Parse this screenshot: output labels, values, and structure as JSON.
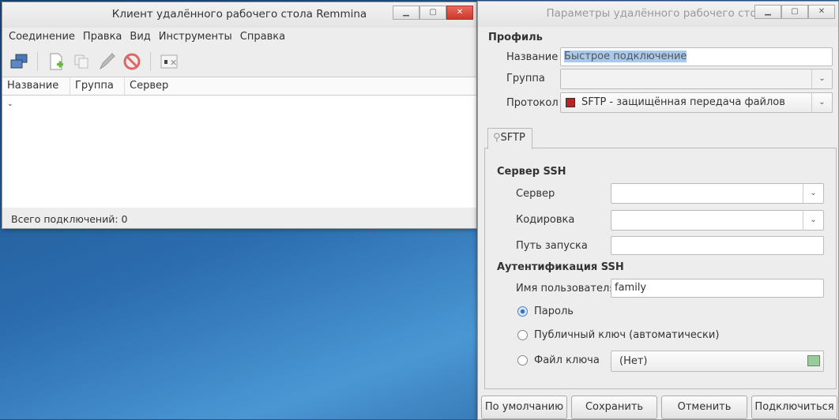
{
  "main_window": {
    "title": "Клиент удалённого рабочего стола Remmina",
    "menu": [
      "Соединение",
      "Правка",
      "Вид",
      "Инструменты",
      "Справка"
    ],
    "columns": [
      "Название",
      "Группа",
      "Сервер"
    ],
    "status": "Всего подключений: 0"
  },
  "dialog": {
    "title": "Параметры удалённого рабочего стола",
    "profile_heading": "Профиль",
    "name_label": "Название",
    "name_value": "Быстрое подключение",
    "group_label": "Группа",
    "group_value": "",
    "protocol_label": "Протокол",
    "protocol_value": "SFTP - защищённая передача файлов",
    "tab": "SFTP",
    "ssh_server_heading": "Сервер SSH",
    "server_label": "Сервер",
    "encoding_label": "Кодировка",
    "startup_path_label": "Путь запуска",
    "ssh_auth_heading": "Аутентификация SSH",
    "username_label": "Имя пользователя",
    "username_value": "family",
    "auth_password": "Пароль",
    "auth_pubkey": "Публичный ключ (автоматически)",
    "auth_keyfile": "Файл ключа",
    "keyfile_value": "(Нет)",
    "buttons": {
      "default": "По умолчанию",
      "save": "Сохранить",
      "cancel": "Отменить",
      "connect": "Подключиться"
    }
  }
}
